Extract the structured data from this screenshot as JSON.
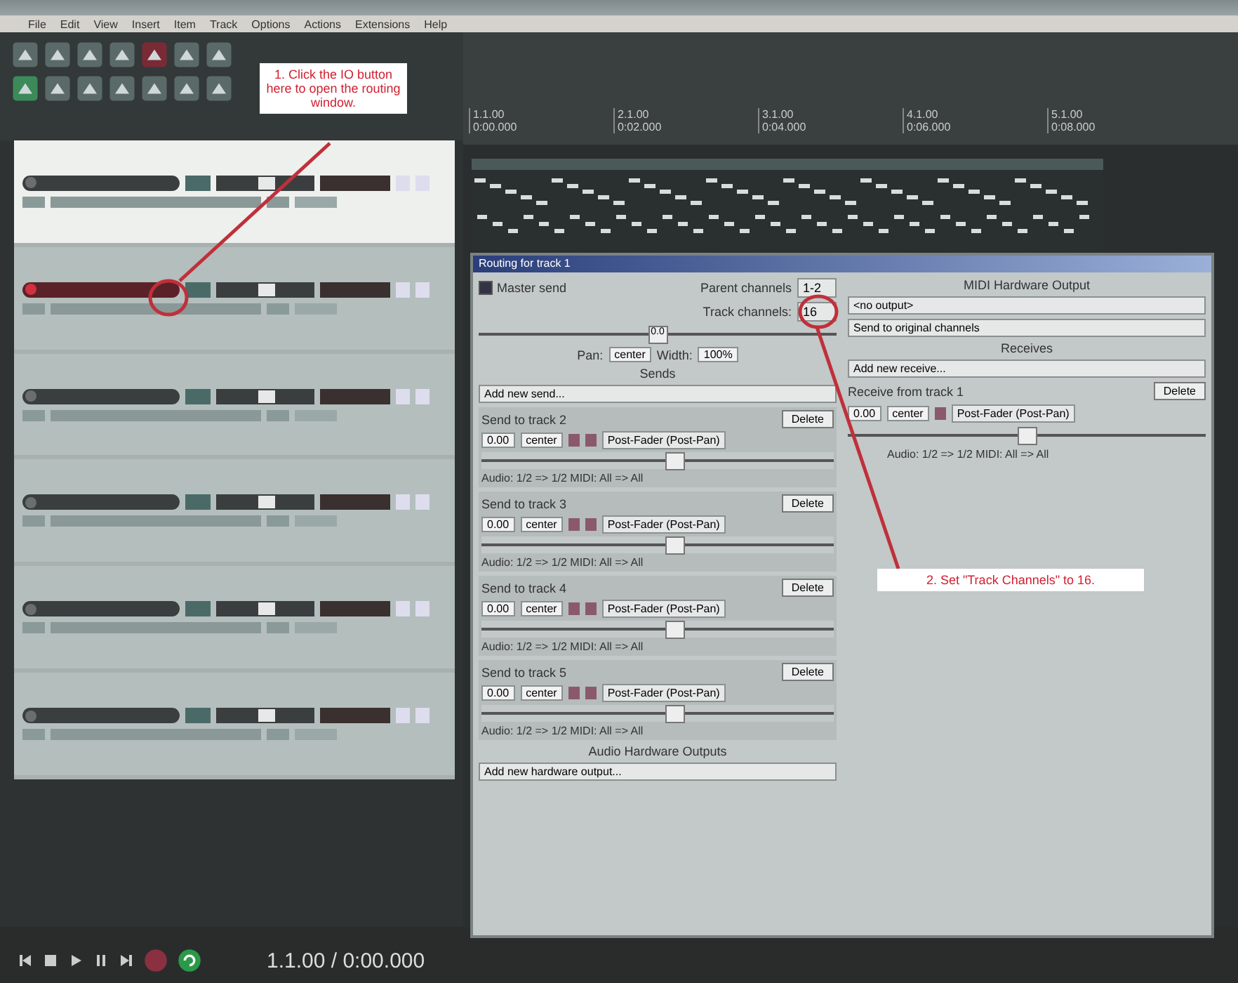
{
  "menu": [
    "File",
    "Edit",
    "View",
    "Insert",
    "Item",
    "Track",
    "Options",
    "Actions",
    "Extensions",
    "Help"
  ],
  "ruler": [
    {
      "bar": "1.1.00",
      "time": "0:00.000"
    },
    {
      "bar": "2.1.00",
      "time": "0:02.000"
    },
    {
      "bar": "3.1.00",
      "time": "0:04.000"
    },
    {
      "bar": "4.1.00",
      "time": "0:06.000"
    },
    {
      "bar": "5.1.00",
      "time": "0:08.000"
    }
  ],
  "tracks": [
    {
      "selected": true,
      "armed": false
    },
    {
      "selected": false,
      "armed": true
    },
    {
      "selected": false,
      "armed": false
    },
    {
      "selected": false,
      "armed": false
    },
    {
      "selected": false,
      "armed": false
    },
    {
      "selected": false,
      "armed": false
    }
  ],
  "callouts": [
    "1. Click the IO button here to open the routing window.",
    "2. Set \"Track Channels\" to 16."
  ],
  "dialog": {
    "title": "Routing for track 1",
    "master_send": {
      "label": "Master send",
      "checked": true
    },
    "parent_label": "Parent channels",
    "parent_value": "1-2",
    "channels_label": "Track channels:",
    "channels_value": "16",
    "volume": {
      "reading": "0.0",
      "level": 0.5
    },
    "pan_label": "Pan:",
    "pan_value": "center",
    "width_label": "Width:",
    "width_value": "100%",
    "sends_label": "Sends",
    "sends_dropdown": "Add new send...",
    "sends": [
      {
        "title": "Send to track 2",
        "delete": "Delete",
        "volume": "0.00",
        "pan": "center",
        "mode": "Post-Fader (Post-Pan)",
        "routing": "Audio: 1/2 => 1/2  MIDI: All => All",
        "level": 0.55
      },
      {
        "title": "Send to track 3",
        "delete": "Delete",
        "volume": "0.00",
        "pan": "center",
        "mode": "Post-Fader (Post-Pan)",
        "routing": "Audio: 1/2 => 1/2  MIDI: All => All",
        "level": 0.55
      },
      {
        "title": "Send to track 4",
        "delete": "Delete",
        "volume": "0.00",
        "pan": "center",
        "mode": "Post-Fader (Post-Pan)",
        "routing": "Audio: 1/2 => 1/2  MIDI: All => All",
        "level": 0.55
      },
      {
        "title": "Send to track 5",
        "delete": "Delete",
        "volume": "0.00",
        "pan": "center",
        "mode": "Post-Fader (Post-Pan)",
        "routing": "Audio: 1/2 => 1/2  MIDI: All => All",
        "level": 0.55
      }
    ],
    "hw_label": "Audio Hardware Outputs",
    "hw_dropdown": "Add new hardware output...",
    "midi_label": "MIDI Hardware Output",
    "midi_output": "<no output>",
    "midi_channels": "Send to original channels",
    "receives_label": "Receives",
    "receives_dropdown": "Add new receive...",
    "receive": {
      "title": "Receive from track 1",
      "delete": "Delete",
      "volume": "0.00",
      "pan": "center",
      "mode": "Post-Fader (Post-Pan)",
      "routing": "Audio: 1/2 => 1/2  MIDI: All => All",
      "level": 0.5
    }
  },
  "transport": {
    "time": "1.1.00 / 0:00.000"
  }
}
